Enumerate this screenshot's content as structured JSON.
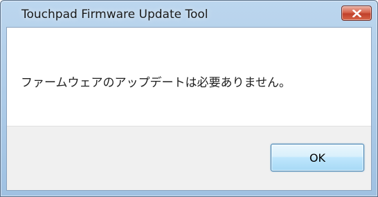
{
  "window": {
    "title": "Touchpad Firmware Update Tool"
  },
  "message": {
    "text": "ファームウェアのアップデートは必要ありません。"
  },
  "buttons": {
    "ok_label": "OK"
  },
  "icons": {
    "close": "close-icon"
  },
  "colors": {
    "titlebar": "#b3d0ec",
    "close_button": "#c9462f",
    "ok_button_border": "#3c7fb1",
    "button_strip": "#f0f0f0"
  }
}
